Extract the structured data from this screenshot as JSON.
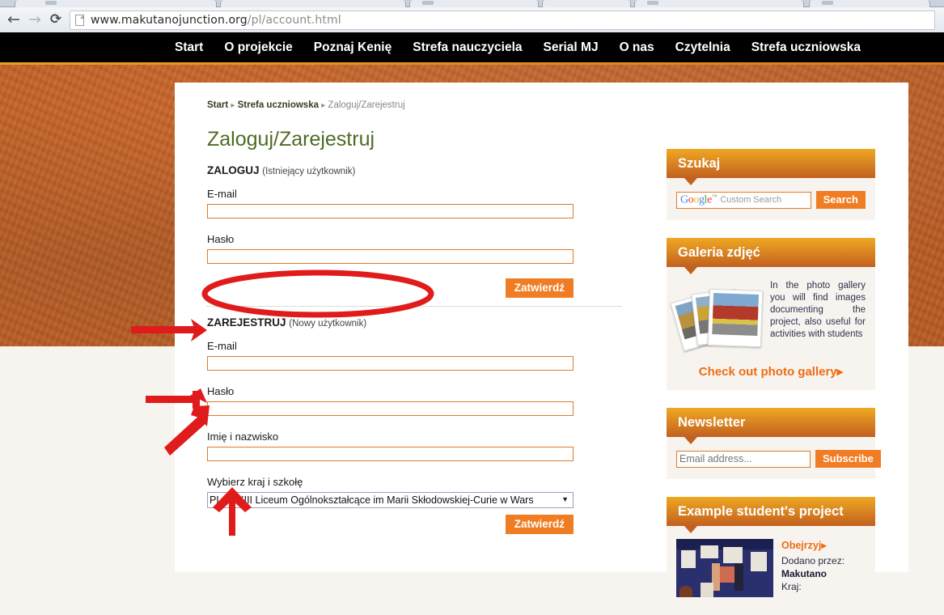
{
  "browser": {
    "url_bold": "www.makutanojunction.org",
    "url_dim": "/pl/account.html",
    "back_glyph": "←",
    "forward_glyph": "→",
    "reload_glyph": "⟳"
  },
  "topnav": {
    "items": [
      {
        "label": "Start"
      },
      {
        "label": "O projekcie"
      },
      {
        "label": "Poznaj Kenię"
      },
      {
        "label": "Strefa nauczyciela"
      },
      {
        "label": "Serial MJ"
      },
      {
        "label": "O nas"
      },
      {
        "label": "Czytelnia"
      },
      {
        "label": "Strefa uczniowska"
      }
    ]
  },
  "breadcrumb": {
    "items": [
      "Start",
      "Strefa uczniowska",
      "Zaloguj/Zarejestruj"
    ],
    "separator": "▸"
  },
  "main": {
    "title": "Zaloguj/Zarejestruj",
    "login": {
      "heading": "ZALOGUJ",
      "heading_note": "(Istniejący użytkownik)",
      "email_label": "E-mail",
      "email_value": "",
      "password_label": "Hasło",
      "password_value": "",
      "submit_label": "Zatwierdź"
    },
    "register": {
      "heading": "ZAREJESTRUJ",
      "heading_note": "(Nowy użytkownik)",
      "email_label": "E-mail",
      "email_value": "",
      "password_label": "Hasło",
      "password_value": "",
      "name_label": "Imię i nazwisko",
      "name_value": "",
      "school_label": "Wybierz kraj i szkołę",
      "school_value": "PL - XXIII Liceum Ogólnokształcące im Marii Skłodowskiej-Curie w Wars",
      "school_caret": "▼",
      "submit_label": "Zatwierdź"
    }
  },
  "sidebar": {
    "search": {
      "title": "Szukaj",
      "brand": "Google",
      "brand_tm": "™",
      "placeholder": "Custom Search",
      "button_label": "Search"
    },
    "gallery": {
      "title": "Galeria zdjęć",
      "text": "In the photo gallery you will find images documenting the project, also useful for activities with students",
      "link_label": "Check out photo gallery",
      "link_caret": "▸"
    },
    "newsletter": {
      "title": "Newsletter",
      "placeholder": "Email address...",
      "button_label": "Subscribe"
    },
    "project": {
      "title": "Example student's project",
      "link_label": "Obejrzyj",
      "link_caret": "▸",
      "added_by_label": "Dodano przez:",
      "added_by_value": "Makutano",
      "country_label": "Kraj:"
    }
  },
  "colors": {
    "accent_orange": "#f07d23",
    "header_gradient_top": "#efa823",
    "header_gradient_bottom": "#c2601f",
    "backdrop_orange": "#bf5f25",
    "nav_black": "#000000",
    "title_green": "#4d6b22",
    "annotation_red": "#e01b1b",
    "input_border": "#e07b28"
  },
  "annotations": {
    "ellipse_label": "red-ellipse-around-register-heading",
    "arrow_1_label": "red-arrow-to-register-email-field",
    "arrow_2_label": "red-arrow-to-register-name-field",
    "arrow_3_label": "red-arrow-to-school-select",
    "arrow_4_label": "red-up-arrow-under-school-select"
  }
}
